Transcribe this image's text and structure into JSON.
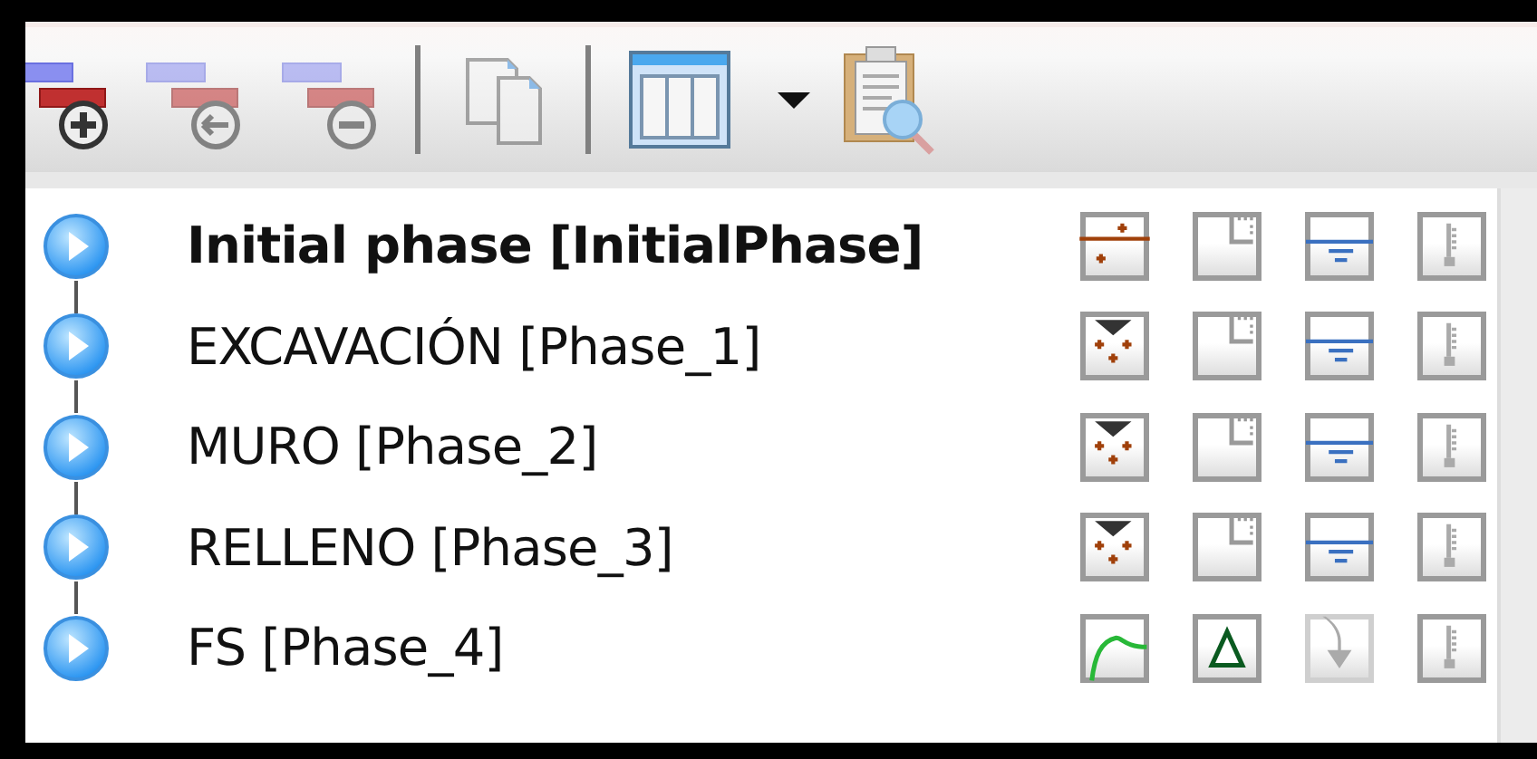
{
  "toolbar": {
    "groups": [
      [
        {
          "kind": "add",
          "disabled": false
        },
        {
          "kind": "insert",
          "disabled": true
        },
        {
          "kind": "delete",
          "disabled": true
        }
      ],
      [
        {
          "kind": "copy",
          "disabled": true
        }
      ],
      [
        {
          "kind": "table",
          "disabled": false
        },
        {
          "kind": "dropdown",
          "disabled": false
        },
        {
          "kind": "preview",
          "disabled": false
        }
      ]
    ]
  },
  "phases": [
    {
      "label": "Initial phase [InitialPhase]",
      "current": true,
      "icons": [
        {
          "kind": "k0",
          "disabled": false
        },
        {
          "kind": "notch",
          "disabled": false
        },
        {
          "kind": "water",
          "disabled": false
        },
        {
          "kind": "thermal",
          "disabled": false
        }
      ]
    },
    {
      "label": "EXCAVACIÓN [Phase_1]",
      "current": false,
      "icons": [
        {
          "kind": "gravity",
          "disabled": false
        },
        {
          "kind": "notch",
          "disabled": false
        },
        {
          "kind": "water",
          "disabled": false
        },
        {
          "kind": "thermal",
          "disabled": false
        }
      ]
    },
    {
      "label": "MURO [Phase_2]",
      "current": false,
      "icons": [
        {
          "kind": "gravity",
          "disabled": false
        },
        {
          "kind": "notch",
          "disabled": false
        },
        {
          "kind": "water",
          "disabled": false
        },
        {
          "kind": "thermal",
          "disabled": false
        }
      ]
    },
    {
      "label": "RELLENO [Phase_3]",
      "current": false,
      "icons": [
        {
          "kind": "gravity",
          "disabled": false
        },
        {
          "kind": "notch",
          "disabled": false
        },
        {
          "kind": "water",
          "disabled": false
        },
        {
          "kind": "thermal",
          "disabled": false
        }
      ]
    },
    {
      "label": "FS [Phase_4]",
      "current": false,
      "icons": [
        {
          "kind": "safety",
          "disabled": false
        },
        {
          "kind": "triangle",
          "disabled": false
        },
        {
          "kind": "arrow",
          "disabled": true
        },
        {
          "kind": "thermal",
          "disabled": false
        }
      ]
    }
  ]
}
